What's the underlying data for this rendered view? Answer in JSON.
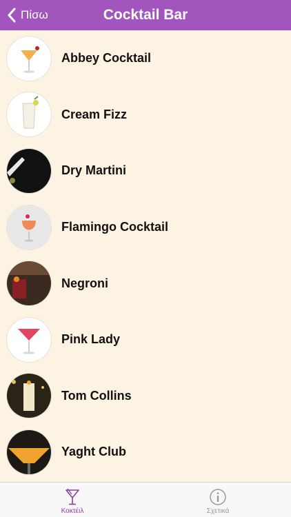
{
  "nav": {
    "back_label": "Πίσω",
    "title": "Cocktail Bar",
    "bar_color": "#a256bd"
  },
  "cocktails": [
    {
      "name": "Abbey Cocktail",
      "icon": "cocktail-photo-abbey"
    },
    {
      "name": "Cream Fizz",
      "icon": "cocktail-photo-cream-fizz"
    },
    {
      "name": "Dry Martini",
      "icon": "cocktail-photo-dry-martini"
    },
    {
      "name": "Flamingo Cocktail",
      "icon": "cocktail-photo-flamingo"
    },
    {
      "name": "Negroni",
      "icon": "cocktail-photo-negroni"
    },
    {
      "name": "Pink Lady",
      "icon": "cocktail-photo-pink-lady"
    },
    {
      "name": "Tom Collins",
      "icon": "cocktail-photo-tom-collins"
    },
    {
      "name": "Yaght Club",
      "icon": "cocktail-photo-yacht-club"
    }
  ],
  "tabs": [
    {
      "label": "Κοκτέιλ",
      "icon": "martini-glass-icon",
      "selected": true,
      "color": "#8e3aa8"
    },
    {
      "label": "Σχετικά",
      "icon": "info-icon",
      "selected": false,
      "color": "#9a9a9a"
    }
  ]
}
